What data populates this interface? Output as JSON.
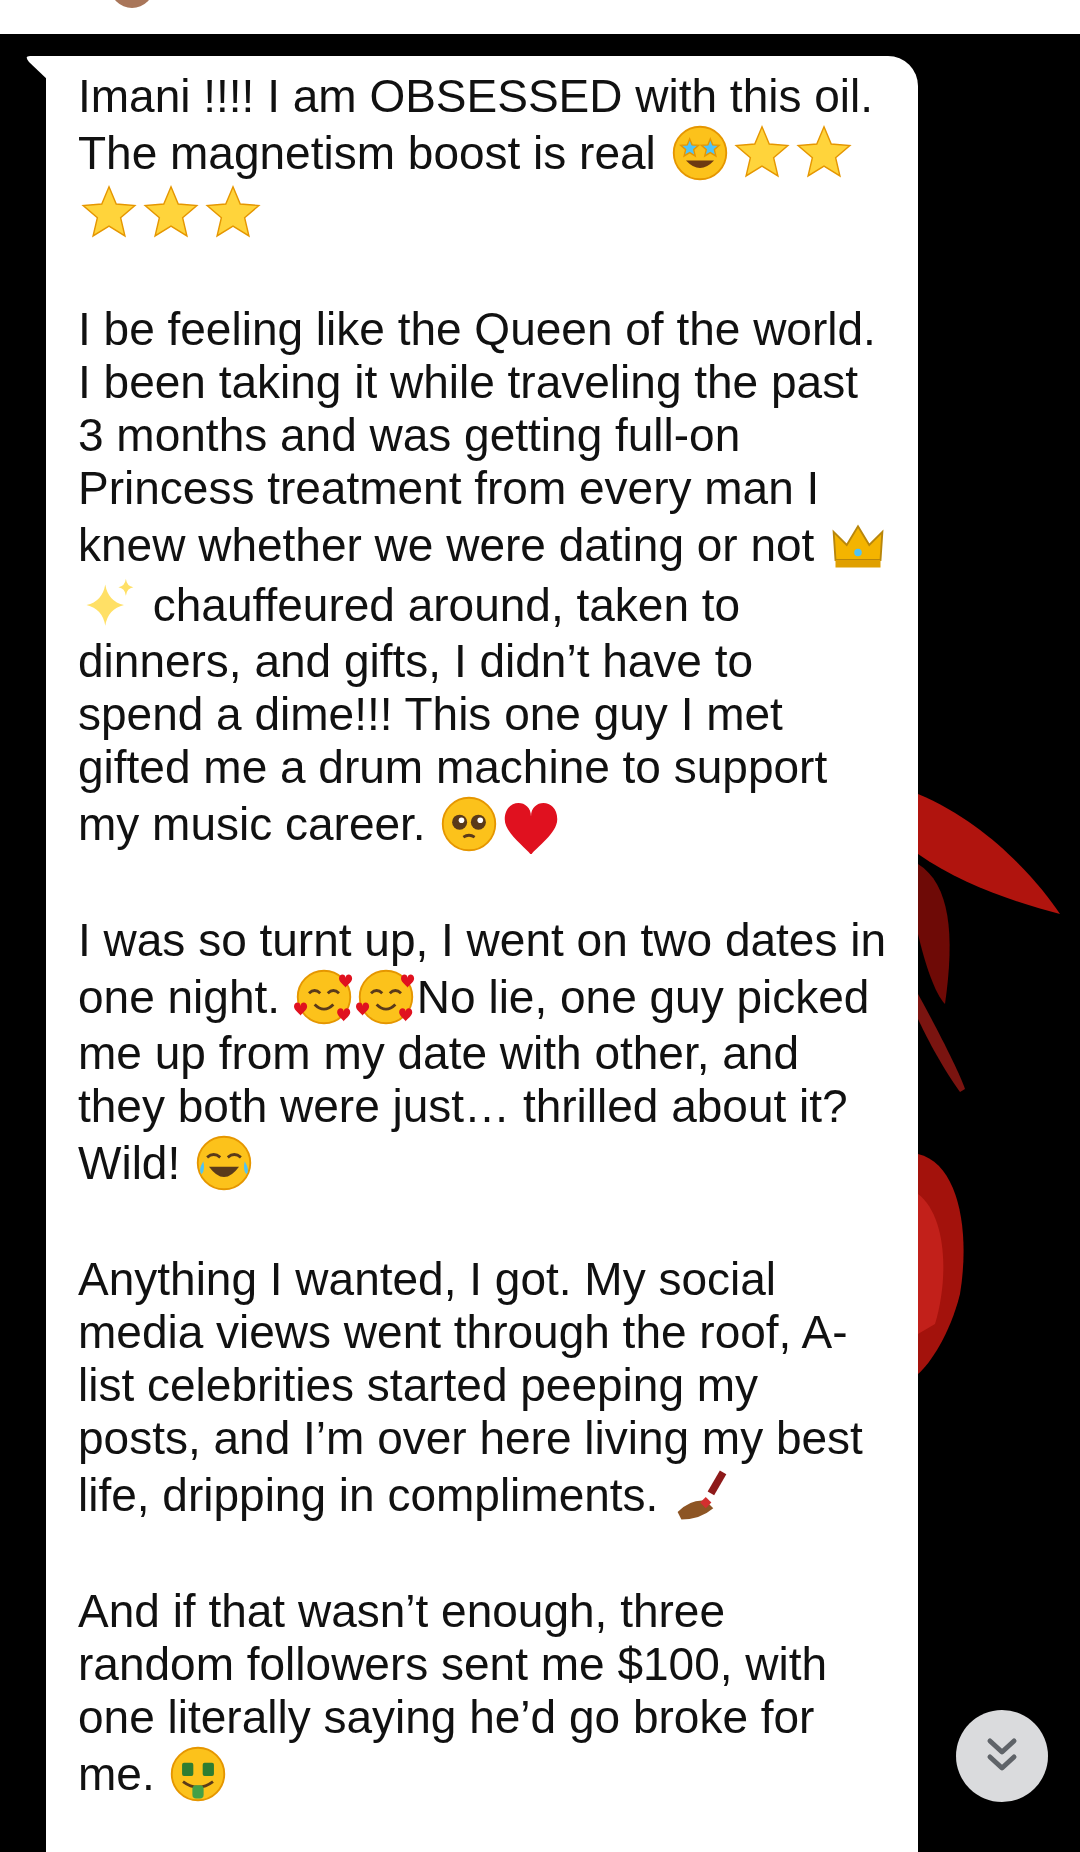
{
  "message": {
    "paragraphs": [
      [
        {
          "kind": "text",
          "text": "Imani !!!! I am OBSESSED with this oil. The magnetism boost is real "
        },
        {
          "kind": "star_face"
        },
        {
          "kind": "star"
        },
        {
          "kind": "star"
        },
        {
          "kind": "star"
        },
        {
          "kind": "star"
        },
        {
          "kind": "star"
        }
      ],
      [
        {
          "kind": "text",
          "text": "I be feeling like the Queen of the world. I been taking it while traveling the past 3 months and was getting full-on Princess treatment from every man I knew whether we were dating or not "
        },
        {
          "kind": "crown"
        },
        {
          "kind": "sparkles"
        },
        {
          "kind": "text",
          "text": " chauffeured around, taken to dinners, and gifts, I didn’t have to spend a dime!!! This one guy I met gifted me a drum machine to support my music career. "
        },
        {
          "kind": "teary_face"
        },
        {
          "kind": "heart"
        }
      ],
      [
        {
          "kind": "text",
          "text": "I was so turnt up, I went on two dates in one night. "
        },
        {
          "kind": "hearts_face"
        },
        {
          "kind": "hearts_face"
        },
        {
          "kind": "text",
          "text": "No lie, one guy picked me up from my date with other, and they both were just… thrilled about it? Wild! "
        },
        {
          "kind": "laugh_face"
        }
      ],
      [
        {
          "kind": "text",
          "text": "Anything I wanted, I got. My social media views went through the roof, A-list celebrities started peeping my posts, and I’m over here living my best life, dripping in compliments. "
        },
        {
          "kind": "nail_polish"
        }
      ],
      [
        {
          "kind": "text",
          "text": "And if that wasn’t enough, three random followers sent me $100, with one literally saying he’d go broke for me. "
        },
        {
          "kind": "money_face"
        }
      ]
    ]
  }
}
